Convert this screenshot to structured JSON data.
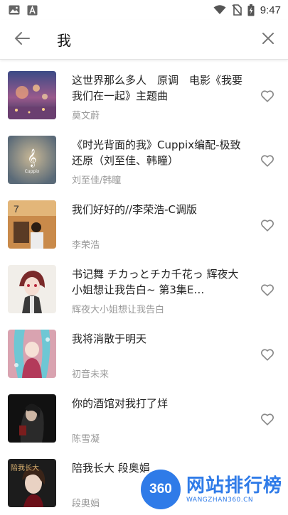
{
  "status_bar": {
    "time": "9:47",
    "left_icons": [
      "image-icon",
      "a-font-icon"
    ],
    "right_icons": [
      "wifi-icon",
      "no-sim-icon",
      "battery-charging-icon"
    ]
  },
  "search": {
    "query": "我",
    "back_icon": "arrow-left-icon",
    "clear_icon": "close-icon"
  },
  "songs": [
    {
      "title": "这世界那么多人　原调　电影《我要我们在一起》主题曲",
      "artist": "莫文蔚"
    },
    {
      "title": "《时光背面的我》Cuppix编配-极致还原（刘至佳、韩瞳）",
      "artist": "刘至佳/韩瞳"
    },
    {
      "title": "我们好好的//李荣浩-C调版",
      "artist": "李荣浩"
    },
    {
      "title": "书记舞 チカっとチカ千花っ 辉夜大小姐想让我告白~ 第3集E…",
      "artist": "辉夜大小姐想让我告白"
    },
    {
      "title": "我将消散于明天",
      "artist": "初音未来"
    },
    {
      "title": "你的酒馆对我打了烊",
      "artist": "陈雪凝"
    },
    {
      "title": "陪我长大 段奥娟",
      "artist": "段奥娟"
    }
  ],
  "covers": {
    "cover_1_text": "",
    "cover_2_text": "Cuppix",
    "cover_3_text": "7",
    "cover_7_text": "陪我长大"
  },
  "watermark": {
    "logo": "360",
    "main": "网站排行榜",
    "sub": "WANGZHAN360.CN"
  },
  "colors": {
    "accent": "#2f7be8",
    "artist_text": "#999999",
    "title_text": "#222222"
  }
}
